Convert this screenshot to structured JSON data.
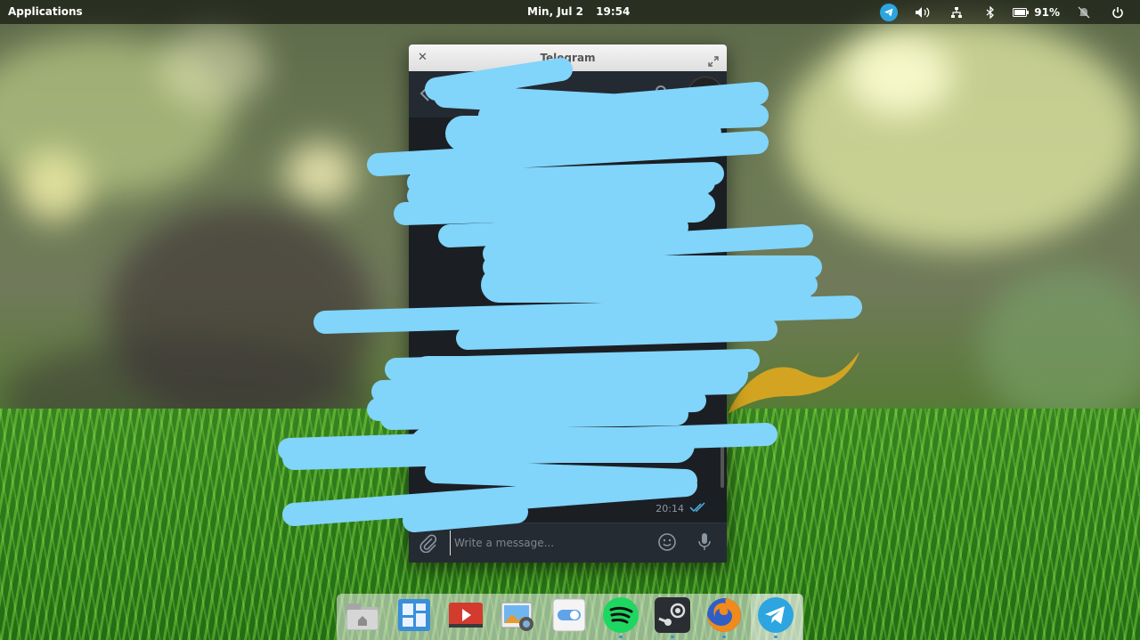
{
  "panel": {
    "applications_label": "Applications",
    "date": "Min, Jul  2",
    "time": "19:54",
    "battery_percent": "91%",
    "tray_icons": [
      "telegram-icon",
      "volume-icon",
      "network-icon",
      "bluetooth-icon",
      "battery-icon",
      "notifications-off-icon",
      "power-icon"
    ]
  },
  "window": {
    "title": "Telegram",
    "message_time": "20:14",
    "composer_placeholder": "Write a message..."
  },
  "dock": {
    "items": [
      "files-icon",
      "multitasking-icon",
      "videos-icon",
      "photos-icon",
      "settings-icon",
      "spotify-icon",
      "steam-icon",
      "firefox-icon",
      "telegram-icon"
    ]
  },
  "colors": {
    "scribble": "#81d4fa",
    "telegram": "#2ca5e0",
    "spotify": "#1ed760",
    "panel_bg": "#000000"
  }
}
